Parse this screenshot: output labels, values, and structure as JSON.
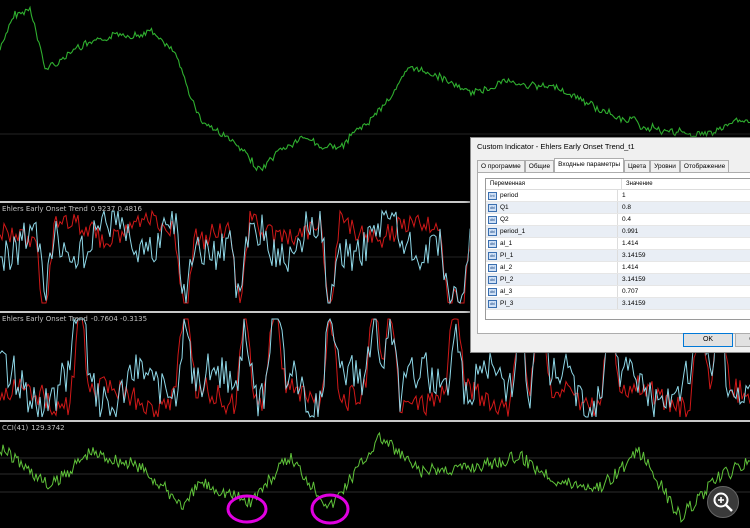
{
  "panes": {
    "indicator1": {
      "name": "Ehlers Early Onset Trend",
      "values": "0.9237 0.4816"
    },
    "indicator2": {
      "name": "Ehlers Early Onset Trend",
      "values": "-0.7604 -0.3135"
    },
    "cci": {
      "name": "CCI(41)",
      "values": "129.3742"
    }
  },
  "dialog": {
    "title": "Custom Indicator - Ehlers Early Onset Trend_t1",
    "tabs": [
      "О программе",
      "Общие",
      "Входные параметры",
      "Цвета",
      "Уровни",
      "Отображение"
    ],
    "active_tab": "Входные параметры",
    "headers": {
      "variable": "Переменная",
      "value": "Значение"
    },
    "params": [
      {
        "icon": "int",
        "name": "period",
        "value": "1"
      },
      {
        "icon": "dbl",
        "name": "Q1",
        "value": "0.8"
      },
      {
        "icon": "dbl",
        "name": "Q2",
        "value": "0.4"
      },
      {
        "icon": "dbl",
        "name": "period_1",
        "value": "0.991"
      },
      {
        "icon": "dbl",
        "name": "al_1",
        "value": "1.414"
      },
      {
        "icon": "dbl",
        "name": "PI_1",
        "value": "3.14159"
      },
      {
        "icon": "dbl",
        "name": "al_2",
        "value": "1.414"
      },
      {
        "icon": "dbl",
        "name": "PI_2",
        "value": "3.14159"
      },
      {
        "icon": "dbl",
        "name": "al_3",
        "value": "0.707"
      },
      {
        "icon": "dbl",
        "name": "PI_3",
        "value": "3.14159"
      }
    ],
    "ok_label": "OK",
    "cancel_label": "Отм"
  },
  "colors": {
    "price": "#2fae2f",
    "signal_red": "#d01818",
    "signal_cyan": "#8fd8e8",
    "cci": "#5fc23a",
    "annotation": "#e000e0"
  }
}
